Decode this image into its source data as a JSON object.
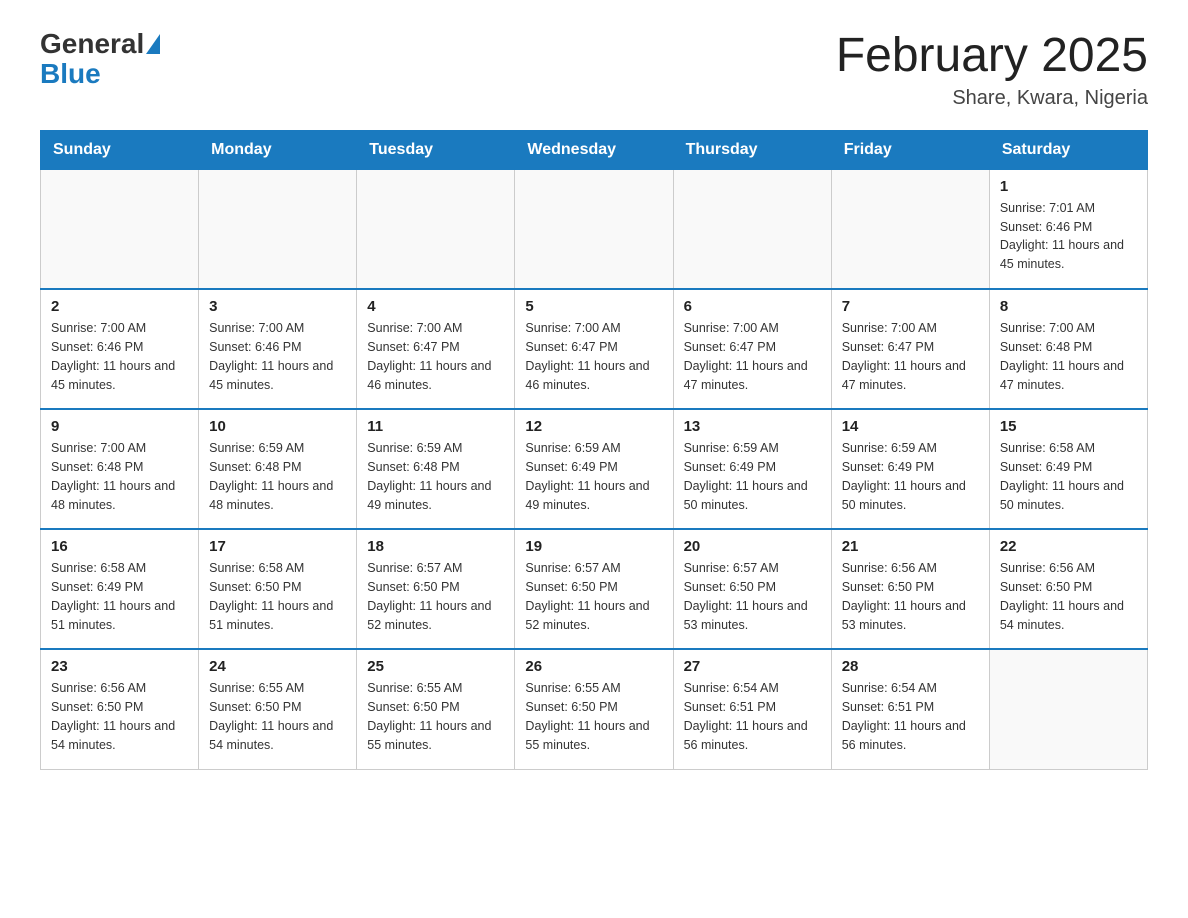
{
  "header": {
    "logo": {
      "general": "General",
      "blue": "Blue"
    },
    "title": "February 2025",
    "subtitle": "Share, Kwara, Nigeria"
  },
  "weekdays": [
    "Sunday",
    "Monday",
    "Tuesday",
    "Wednesday",
    "Thursday",
    "Friday",
    "Saturday"
  ],
  "weeks": [
    [
      {
        "day": "",
        "info": ""
      },
      {
        "day": "",
        "info": ""
      },
      {
        "day": "",
        "info": ""
      },
      {
        "day": "",
        "info": ""
      },
      {
        "day": "",
        "info": ""
      },
      {
        "day": "",
        "info": ""
      },
      {
        "day": "1",
        "info": "Sunrise: 7:01 AM\nSunset: 6:46 PM\nDaylight: 11 hours and 45 minutes."
      }
    ],
    [
      {
        "day": "2",
        "info": "Sunrise: 7:00 AM\nSunset: 6:46 PM\nDaylight: 11 hours and 45 minutes."
      },
      {
        "day": "3",
        "info": "Sunrise: 7:00 AM\nSunset: 6:46 PM\nDaylight: 11 hours and 45 minutes."
      },
      {
        "day": "4",
        "info": "Sunrise: 7:00 AM\nSunset: 6:47 PM\nDaylight: 11 hours and 46 minutes."
      },
      {
        "day": "5",
        "info": "Sunrise: 7:00 AM\nSunset: 6:47 PM\nDaylight: 11 hours and 46 minutes."
      },
      {
        "day": "6",
        "info": "Sunrise: 7:00 AM\nSunset: 6:47 PM\nDaylight: 11 hours and 47 minutes."
      },
      {
        "day": "7",
        "info": "Sunrise: 7:00 AM\nSunset: 6:47 PM\nDaylight: 11 hours and 47 minutes."
      },
      {
        "day": "8",
        "info": "Sunrise: 7:00 AM\nSunset: 6:48 PM\nDaylight: 11 hours and 47 minutes."
      }
    ],
    [
      {
        "day": "9",
        "info": "Sunrise: 7:00 AM\nSunset: 6:48 PM\nDaylight: 11 hours and 48 minutes."
      },
      {
        "day": "10",
        "info": "Sunrise: 6:59 AM\nSunset: 6:48 PM\nDaylight: 11 hours and 48 minutes."
      },
      {
        "day": "11",
        "info": "Sunrise: 6:59 AM\nSunset: 6:48 PM\nDaylight: 11 hours and 49 minutes."
      },
      {
        "day": "12",
        "info": "Sunrise: 6:59 AM\nSunset: 6:49 PM\nDaylight: 11 hours and 49 minutes."
      },
      {
        "day": "13",
        "info": "Sunrise: 6:59 AM\nSunset: 6:49 PM\nDaylight: 11 hours and 50 minutes."
      },
      {
        "day": "14",
        "info": "Sunrise: 6:59 AM\nSunset: 6:49 PM\nDaylight: 11 hours and 50 minutes."
      },
      {
        "day": "15",
        "info": "Sunrise: 6:58 AM\nSunset: 6:49 PM\nDaylight: 11 hours and 50 minutes."
      }
    ],
    [
      {
        "day": "16",
        "info": "Sunrise: 6:58 AM\nSunset: 6:49 PM\nDaylight: 11 hours and 51 minutes."
      },
      {
        "day": "17",
        "info": "Sunrise: 6:58 AM\nSunset: 6:50 PM\nDaylight: 11 hours and 51 minutes."
      },
      {
        "day": "18",
        "info": "Sunrise: 6:57 AM\nSunset: 6:50 PM\nDaylight: 11 hours and 52 minutes."
      },
      {
        "day": "19",
        "info": "Sunrise: 6:57 AM\nSunset: 6:50 PM\nDaylight: 11 hours and 52 minutes."
      },
      {
        "day": "20",
        "info": "Sunrise: 6:57 AM\nSunset: 6:50 PM\nDaylight: 11 hours and 53 minutes."
      },
      {
        "day": "21",
        "info": "Sunrise: 6:56 AM\nSunset: 6:50 PM\nDaylight: 11 hours and 53 minutes."
      },
      {
        "day": "22",
        "info": "Sunrise: 6:56 AM\nSunset: 6:50 PM\nDaylight: 11 hours and 54 minutes."
      }
    ],
    [
      {
        "day": "23",
        "info": "Sunrise: 6:56 AM\nSunset: 6:50 PM\nDaylight: 11 hours and 54 minutes."
      },
      {
        "day": "24",
        "info": "Sunrise: 6:55 AM\nSunset: 6:50 PM\nDaylight: 11 hours and 54 minutes."
      },
      {
        "day": "25",
        "info": "Sunrise: 6:55 AM\nSunset: 6:50 PM\nDaylight: 11 hours and 55 minutes."
      },
      {
        "day": "26",
        "info": "Sunrise: 6:55 AM\nSunset: 6:50 PM\nDaylight: 11 hours and 55 minutes."
      },
      {
        "day": "27",
        "info": "Sunrise: 6:54 AM\nSunset: 6:51 PM\nDaylight: 11 hours and 56 minutes."
      },
      {
        "day": "28",
        "info": "Sunrise: 6:54 AM\nSunset: 6:51 PM\nDaylight: 11 hours and 56 minutes."
      },
      {
        "day": "",
        "info": ""
      }
    ]
  ]
}
